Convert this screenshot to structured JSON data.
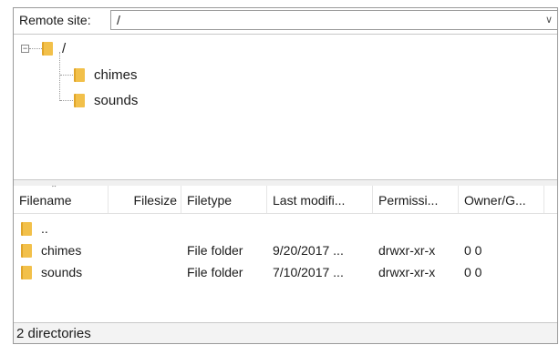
{
  "remote_site": {
    "label": "Remote site:",
    "path": "/"
  },
  "tree": {
    "root": {
      "expander": "−",
      "label": "/"
    },
    "children": [
      {
        "label": "chimes"
      },
      {
        "label": "sounds"
      }
    ]
  },
  "file_list": {
    "columns": [
      "Filename",
      "Filesize",
      "Filetype",
      "Last modifi...",
      "Permissi...",
      "Owner/G..."
    ],
    "rows": [
      {
        "name": "..",
        "size": "",
        "type": "",
        "modified": "",
        "permissions": "",
        "owner": ""
      },
      {
        "name": "chimes",
        "size": "",
        "type": "File folder",
        "modified": "9/20/2017 ...",
        "permissions": "drwxr-xr-x",
        "owner": "0 0"
      },
      {
        "name": "sounds",
        "size": "",
        "type": "File folder",
        "modified": "7/10/2017 ...",
        "permissions": "drwxr-xr-x",
        "owner": "0 0"
      }
    ]
  },
  "status": {
    "text": "2 directories"
  },
  "colors": {
    "folder": "#f2c04a",
    "border": "#9a9a9a",
    "status_bg": "#f3f3f3"
  }
}
